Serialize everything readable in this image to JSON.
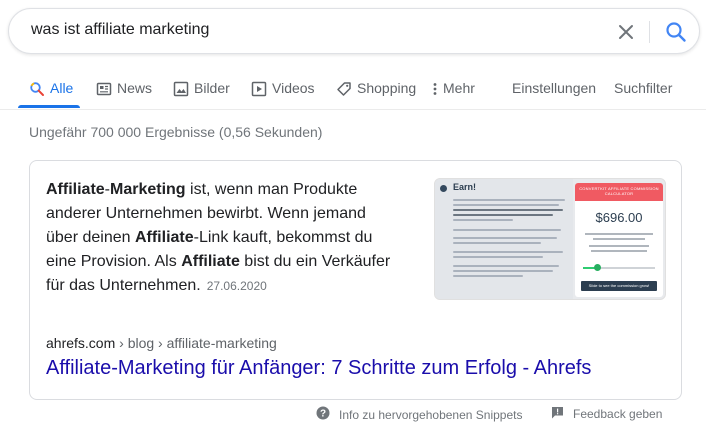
{
  "search": {
    "query": "was ist affiliate marketing",
    "clear_icon": "close-icon",
    "search_icon": "search-icon"
  },
  "tabs": [
    {
      "label": "Alle",
      "icon": "search-icon",
      "active": true
    },
    {
      "label": "News",
      "icon": "news-icon"
    },
    {
      "label": "Bilder",
      "icon": "image-icon"
    },
    {
      "label": "Videos",
      "icon": "video-icon"
    },
    {
      "label": "Shopping",
      "icon": "tag-icon"
    },
    {
      "label": "Mehr",
      "icon": "more-vert-icon"
    }
  ],
  "tools": {
    "settings": "Einstellungen",
    "filter": "Suchfilter"
  },
  "result_stats": "Ungefähr 700 000 Ergebnisse (0,56 Sekunden)",
  "snippet": {
    "segments": [
      {
        "text": "Affiliate",
        "bold": true
      },
      {
        "text": "-",
        "bold": false
      },
      {
        "text": "Marketing",
        "bold": true
      },
      {
        "text": " ist, wenn man Produkte anderer Unternehmen bewirbt. Wenn jemand über deinen ",
        "bold": false
      },
      {
        "text": "Affiliate",
        "bold": true
      },
      {
        "text": "-Link kauft, bekommst du eine Provision. Als ",
        "bold": false
      },
      {
        "text": "Affiliate",
        "bold": true
      },
      {
        "text": " bist du ein Verkäufer für das Unternehmen.",
        "bold": false
      }
    ],
    "date": "27.06.2020",
    "image": {
      "title": "Earn!",
      "calc_header": "CONVERTKIT AFFILIATE COMMISSION CALCULATOR",
      "calc_value": "$696.00",
      "calc_button": "Slide to see the commission grow!"
    },
    "cite_domain": "ahrefs.com",
    "cite_path": " › blog › affiliate-marketing",
    "title": "Affiliate-Marketing für Anfänger: 7 Schritte zum Erfolg - Ahrefs"
  },
  "footer": {
    "about_label": "Info zu hervorgehobenen Snippets",
    "about_icon": "help-circle-icon",
    "feedback_label": "Feedback geben",
    "feedback_icon": "feedback-icon"
  },
  "colors": {
    "accent": "#1a73e8",
    "link": "#1a0dab",
    "muted": "#70757a"
  }
}
